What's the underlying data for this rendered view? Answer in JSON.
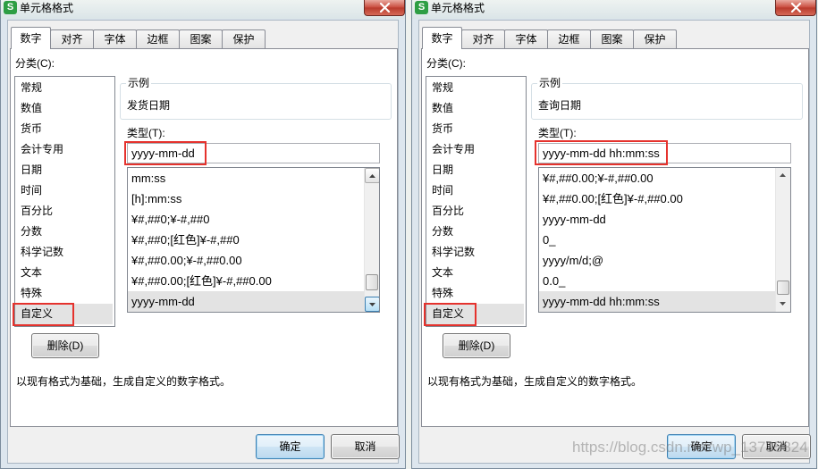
{
  "dialogs": [
    {
      "app_icon_glyph": "S",
      "title": "单元格格式",
      "tabs": [
        "数字",
        "对齐",
        "字体",
        "边框",
        "图案",
        "保护"
      ],
      "active_tab_index": 0,
      "category_label": "分类(C):",
      "categories": [
        "常规",
        "数值",
        "货币",
        "会计专用",
        "日期",
        "时间",
        "百分比",
        "分数",
        "科学记数",
        "文本",
        "特殊",
        "自定义"
      ],
      "selected_category_index": 11,
      "sample_label": "示例",
      "sample_text": "发货日期",
      "type_label": "类型(T):",
      "type_value": "yyyy-mm-dd",
      "type_list": [
        "mm:ss",
        "[h]:mm:ss",
        "¥#,##0;¥-#,##0",
        "¥#,##0;[红色]¥-#,##0",
        "¥#,##0.00;¥-#,##0.00",
        "¥#,##0.00;[红色]¥-#,##0.00",
        "yyyy-mm-dd"
      ],
      "selected_type_index": 6,
      "type_list_scroll_position": 0.94,
      "delete_label": "删除(D)",
      "description": "以现有格式为基础，生成自定义的数字格式。",
      "ok_label": "确定",
      "cancel_label": "取消"
    },
    {
      "app_icon_glyph": "S",
      "title": "单元格格式",
      "tabs": [
        "数字",
        "对齐",
        "字体",
        "边框",
        "图案",
        "保护"
      ],
      "active_tab_index": 0,
      "category_label": "分类(C):",
      "categories": [
        "常规",
        "数值",
        "货币",
        "会计专用",
        "日期",
        "时间",
        "百分比",
        "分数",
        "科学记数",
        "文本",
        "特殊",
        "自定义"
      ],
      "selected_category_index": 11,
      "sample_label": "示例",
      "sample_text": "查询日期",
      "type_label": "类型(T):",
      "type_value": "yyyy-mm-dd hh:mm:ss",
      "type_list": [
        "¥#,##0.00;¥-#,##0.00",
        "¥#,##0.00;[红色]¥-#,##0.00",
        "yyyy-mm-dd",
        "0_",
        "yyyy/m/d;@",
        "0.0_",
        "yyyy-mm-dd hh:mm:ss"
      ],
      "selected_type_index": 6,
      "type_list_scroll_position": 0.98,
      "delete_label": "删除(D)",
      "description": "以现有格式为基础，生成自定义的数字格式。",
      "ok_label": "确定",
      "cancel_label": "取消"
    }
  ],
  "watermark": "https://blog.csdn.net/wp_13735824",
  "colors": {
    "highlight_box": "#e5322d",
    "selection": "#e3e3e3",
    "close_button": "#c94a3c",
    "app_icon": "#2e9e44",
    "default_button_border": "#3c7fb1"
  },
  "icons": {
    "app": "wps-spreadsheet-icon",
    "close": "close-icon",
    "scroll_up": "scroll-up-arrow-icon",
    "scroll_down": "scroll-down-arrow-icon"
  }
}
